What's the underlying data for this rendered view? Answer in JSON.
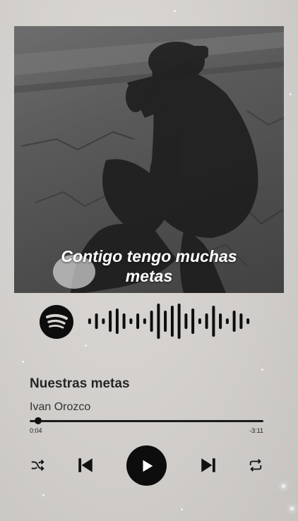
{
  "cover": {
    "lyric_lines": [
      "Contigo tengo muchas",
      "metas"
    ]
  },
  "track": {
    "title": "Nuestras metas",
    "artist": "Ivan Orozco"
  },
  "progress": {
    "elapsed": "0:04",
    "remaining": "-3:11",
    "fraction": 0.02
  },
  "icons": {
    "spotify": "spotify-logo-icon",
    "shuffle": "shuffle-icon",
    "previous": "skip-previous-icon",
    "play": "play-icon",
    "next": "skip-next-icon",
    "repeat": "repeat-icon"
  },
  "colors": {
    "accent": "#0d0d0d",
    "background": "#d6d3d0"
  }
}
